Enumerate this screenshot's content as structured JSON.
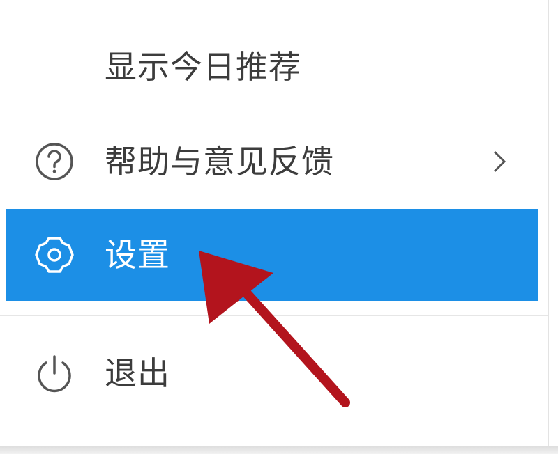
{
  "menu": {
    "items": [
      {
        "label": "显示今日推荐",
        "icon": null
      },
      {
        "label": "帮助与意见反馈",
        "icon": "help-circle-icon",
        "submenu": true
      },
      {
        "label": "设置",
        "icon": "gear-icon",
        "highlighted": true
      },
      {
        "label": "退出",
        "icon": "power-icon"
      }
    ]
  },
  "colors": {
    "highlight": "#1c8fe6",
    "text": "#3c3c3c",
    "annotation_arrow": "#b3141d"
  }
}
